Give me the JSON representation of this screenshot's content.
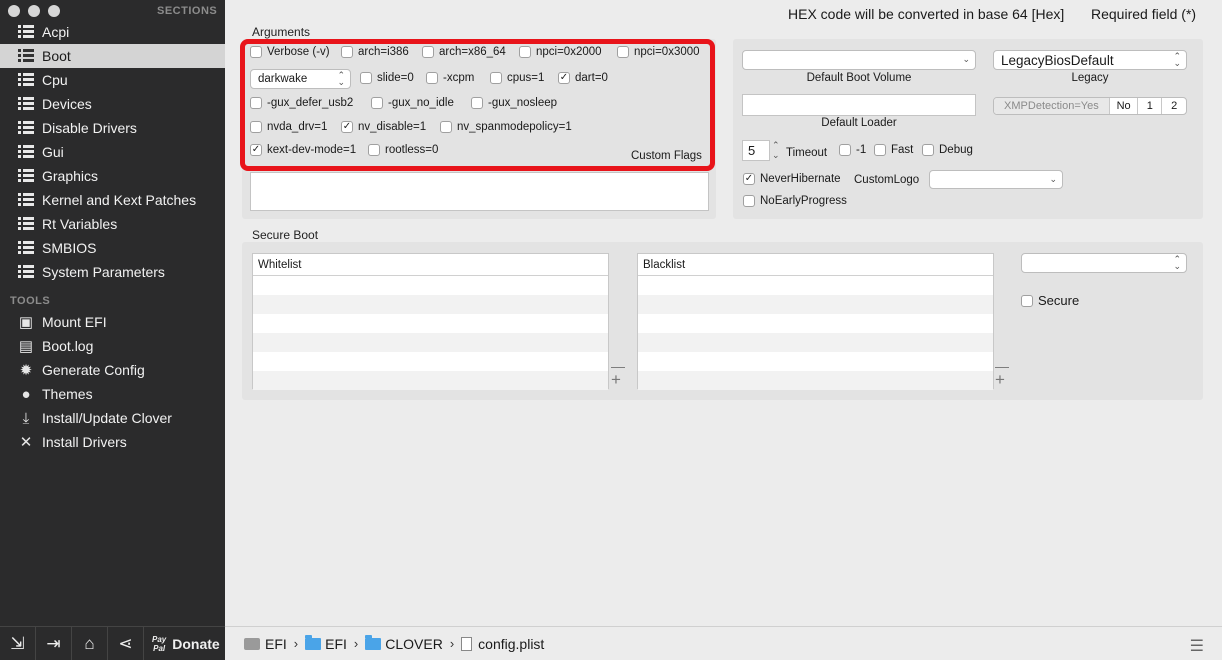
{
  "sidebar": {
    "sections_header": "SECTIONS",
    "sections": [
      {
        "label": "Acpi",
        "selected": false
      },
      {
        "label": "Boot",
        "selected": true
      },
      {
        "label": "Cpu",
        "selected": false
      },
      {
        "label": "Devices",
        "selected": false
      },
      {
        "label": "Disable Drivers",
        "selected": false
      },
      {
        "label": "Gui",
        "selected": false
      },
      {
        "label": "Graphics",
        "selected": false
      },
      {
        "label": "Kernel and Kext Patches",
        "selected": false
      },
      {
        "label": "Rt Variables",
        "selected": false
      },
      {
        "label": "SMBIOS",
        "selected": false
      },
      {
        "label": "System Parameters",
        "selected": false
      }
    ],
    "tools_header": "TOOLS",
    "tools": [
      {
        "label": "Mount EFI",
        "icon": "disk-icon"
      },
      {
        "label": "Boot.log",
        "icon": "log-icon"
      },
      {
        "label": "Generate Config",
        "icon": "gear-icon"
      },
      {
        "label": "Themes",
        "icon": "palette-icon"
      },
      {
        "label": "Install/Update Clover",
        "icon": "download-icon"
      },
      {
        "label": "Install Drivers",
        "icon": "tools-icon"
      }
    ],
    "bottom": {
      "paypal_line1": "Pay",
      "paypal_line2": "Pal",
      "donate_label": "Donate"
    }
  },
  "header": {
    "hex_note": "HEX code will be converted in base 64 [Hex]",
    "required_note": "Required field (*)"
  },
  "arguments": {
    "label": "Arguments",
    "custom_flags_label": "Custom Flags",
    "darkwake_value": "darkwake",
    "flags": {
      "verbose": {
        "label": "Verbose (-v)",
        "checked": false
      },
      "arch_i386": {
        "label": "arch=i386",
        "checked": false
      },
      "arch_x86_64": {
        "label": "arch=x86_64",
        "checked": false
      },
      "npci_2000": {
        "label": "npci=0x2000",
        "checked": false
      },
      "npci_3000": {
        "label": "npci=0x3000",
        "checked": false
      },
      "slide": {
        "label": "slide=0",
        "checked": false
      },
      "xcpm": {
        "label": "-xcpm",
        "checked": false
      },
      "cpus": {
        "label": "cpus=1",
        "checked": false
      },
      "dart": {
        "label": "dart=0",
        "checked": true
      },
      "gux_defer": {
        "label": "-gux_defer_usb2",
        "checked": false
      },
      "gux_no_idle": {
        "label": "-gux_no_idle",
        "checked": false
      },
      "gux_nosleep": {
        "label": "-gux_nosleep",
        "checked": false
      },
      "nvda_drv": {
        "label": "nvda_drv=1",
        "checked": false
      },
      "nv_disable": {
        "label": "nv_disable=1",
        "checked": true
      },
      "nv_spanmode": {
        "label": "nv_spanmodepolicy=1",
        "checked": false
      },
      "kext_dev_mode": {
        "label": "kext-dev-mode=1",
        "checked": true
      },
      "rootless": {
        "label": "rootless=0",
        "checked": false
      }
    },
    "highlight_color": "#e8141a"
  },
  "boot_options": {
    "default_boot_volume_label": "Default Boot Volume",
    "default_boot_volume_value": "",
    "legacy_label": "Legacy",
    "legacy_value": "LegacyBiosDefault",
    "default_loader_label": "Default Loader",
    "default_loader_value": "",
    "xmp": {
      "label": "XMPDetection=Yes",
      "options": [
        "No",
        "1",
        "2"
      ]
    },
    "timeout_value": "5",
    "timeout_label": "Timeout",
    "minus_one": {
      "label": "-1",
      "checked": false
    },
    "fast": {
      "label": "Fast",
      "checked": false
    },
    "debug": {
      "label": "Debug",
      "checked": false
    },
    "never_hibernate": {
      "label": "NeverHibernate",
      "checked": true
    },
    "custom_logo_label": "CustomLogo",
    "custom_logo_value": "",
    "no_early_progress": {
      "label": "NoEarlyProgress",
      "checked": false
    }
  },
  "secure_boot": {
    "label": "Secure Boot",
    "whitelist_header": "Whitelist",
    "blacklist_header": "Blacklist",
    "policy_value": "",
    "secure": {
      "label": "Secure",
      "checked": false
    }
  },
  "pathbar": {
    "items": [
      "EFI",
      "EFI",
      "CLOVER",
      "config.plist"
    ],
    "separator": "›"
  }
}
